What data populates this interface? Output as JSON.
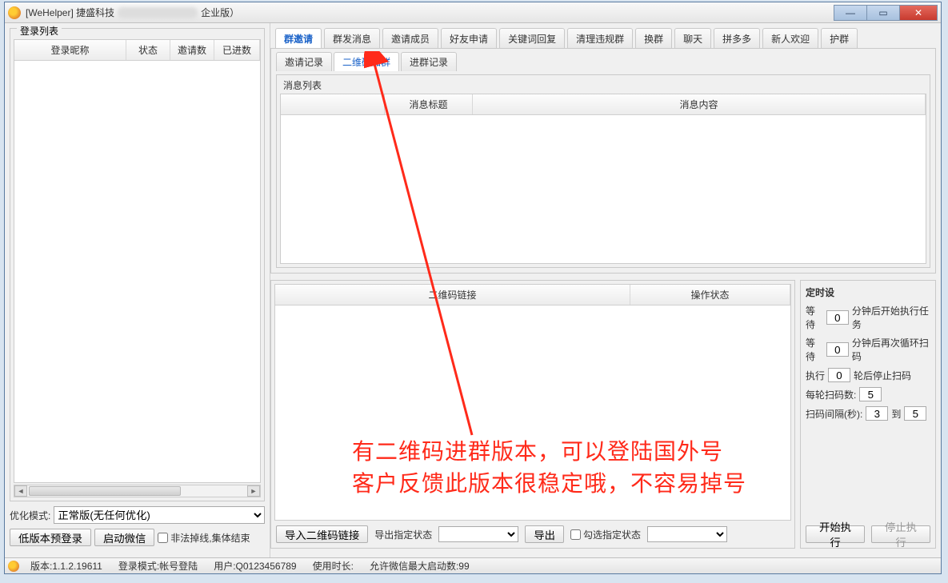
{
  "titlebar": {
    "app": "[WeHelper] 捷盛科技",
    "edition": "企业版）"
  },
  "left": {
    "fieldset_label": "登录列表",
    "columns": {
      "nick": "登录昵称",
      "status": "状态",
      "invite": "邀请数",
      "joined": "已进数"
    },
    "mode_label": "优化模式:",
    "mode_value": "正常版(无任何优化)",
    "btn_low": "低版本预登录",
    "btn_start": "启动微信",
    "chk_offline": "非法掉线,集体结束"
  },
  "main_tabs": [
    "群邀请",
    "群发消息",
    "邀请成员",
    "好友申请",
    "关键词回复",
    "清理违规群",
    "换群",
    "聊天",
    "拼多多",
    "新人欢迎",
    "护群"
  ],
  "active_main_tab": 0,
  "sub_tabs": [
    "邀请记录",
    "二维码加群",
    "进群记录"
  ],
  "active_sub_tab": 1,
  "msg": {
    "fieldset": "消息列表",
    "col_blank": "",
    "col_title": "消息标题",
    "col_content": "消息内容"
  },
  "qr": {
    "col_link": "二维码链接",
    "col_status": "操作状态",
    "btn_import": "导入二维码链接",
    "lbl_export_status": "导出指定状态",
    "btn_export": "导出",
    "chk_check": "勾选指定状态"
  },
  "timer": {
    "title": "定时设",
    "wait1_pre": "等待",
    "wait1_val": "0",
    "wait1_post": "分钟后开始执行任务",
    "wait2_pre": "等待",
    "wait2_val": "0",
    "wait2_post": "分钟后再次循环扫码",
    "exec_pre": "执行",
    "exec_val": "0",
    "exec_post": "轮后停止扫码",
    "perround_pre": "每轮扫码数:",
    "perround_val": "5",
    "interval_pre": "扫码间隔(秒):",
    "interval_from": "3",
    "interval_to_lbl": "到",
    "interval_to": "5",
    "btn_start": "开始执行",
    "btn_stop": "停止执行"
  },
  "status": {
    "version": "版本:1.1.2.19611",
    "login_mode": "登录模式:帐号登陆",
    "user": "用户:Q0123456789",
    "use_time": "使用时长:",
    "max_start": "允许微信最大启动数:99"
  },
  "annotation": {
    "line1": "有二维码进群版本，可以登陆国外号",
    "line2": "客户反馈此版本很稳定哦，不容易掉号"
  }
}
